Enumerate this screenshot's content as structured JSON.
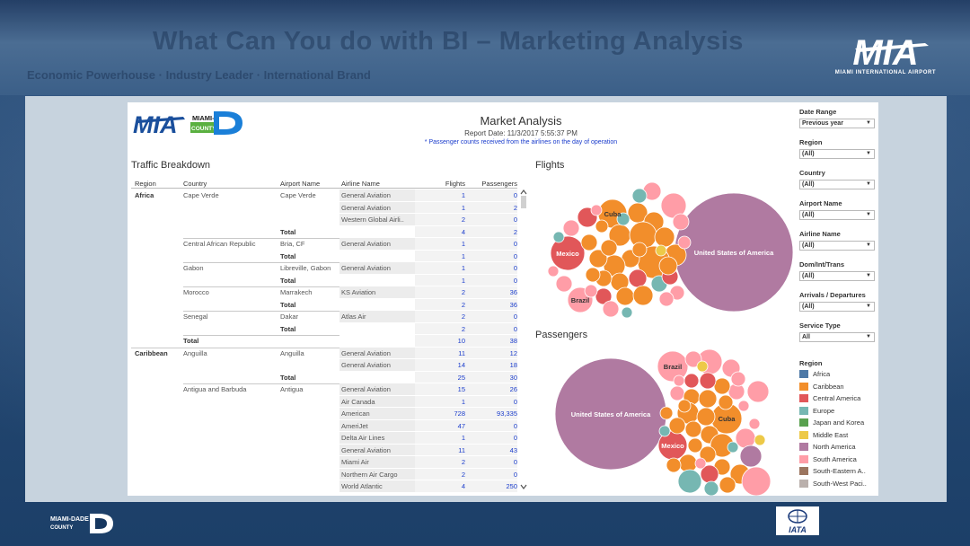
{
  "slide": {
    "title": "What Can You do with BI – Marketing Analysis",
    "subtitle": "Economic Powerhouse · Industry Leader · International Brand",
    "mia_logo_text": "MIA",
    "mia_logo_caption": "MIAMI INTERNATIONAL AIRPORT",
    "county_logo_text": "MIAMI-DADE COUNTY",
    "iata_logo_text": "IATA"
  },
  "dashboard": {
    "title": "Market Analysis",
    "report_date": "Report Date: 11/3/2017 5:55:37 PM",
    "note": "* Passenger counts received from the airlines on the day of operation",
    "traffic_title": "Traffic Breakdown",
    "flights_title": "Flights",
    "passengers_title": "Passengers",
    "table": {
      "headers": {
        "region": "Region",
        "country": "Country",
        "airport": "Airport Name",
        "airline": "Airline Name",
        "flights": "Flights",
        "passengers": "Passengers"
      },
      "rows": [
        {
          "region": "Africa",
          "country": "Cape Verde",
          "airport": "Cape Verde",
          "airline": "General Aviation",
          "flights": "1",
          "passengers": "0"
        },
        {
          "region": "",
          "country": "",
          "airport": "",
          "airline": "General Aviation",
          "flights": "1",
          "passengers": "2"
        },
        {
          "region": "",
          "country": "",
          "airport": "",
          "airline": "Western Global Airli..",
          "flights": "2",
          "passengers": "0"
        },
        {
          "region": "",
          "country": "",
          "airport": "Total",
          "airline": "",
          "flights": "4",
          "passengers": "2",
          "kind": "total"
        },
        {
          "region": "",
          "country": "Central African Republic",
          "airport": "Bria, CF",
          "airline": "General Aviation",
          "flights": "1",
          "passengers": "0"
        },
        {
          "region": "",
          "country": "",
          "airport": "Total",
          "airline": "",
          "flights": "1",
          "passengers": "0",
          "kind": "total"
        },
        {
          "region": "",
          "country": "Gabon",
          "airport": "Libreville, Gabon",
          "airline": "General Aviation",
          "flights": "1",
          "passengers": "0"
        },
        {
          "region": "",
          "country": "",
          "airport": "Total",
          "airline": "",
          "flights": "1",
          "passengers": "0",
          "kind": "total"
        },
        {
          "region": "",
          "country": "Morocco",
          "airport": "Marrakech",
          "airline": "KS Aviation",
          "flights": "2",
          "passengers": "36"
        },
        {
          "region": "",
          "country": "",
          "airport": "Total",
          "airline": "",
          "flights": "2",
          "passengers": "36",
          "kind": "total"
        },
        {
          "region": "",
          "country": "Senegal",
          "airport": "Dakar",
          "airline": "Atlas Air",
          "flights": "2",
          "passengers": "0"
        },
        {
          "region": "",
          "country": "",
          "airport": "Total",
          "airline": "",
          "flights": "2",
          "passengers": "0",
          "kind": "total"
        },
        {
          "region": "",
          "country": "Total",
          "airport": "",
          "airline": "",
          "flights": "10",
          "passengers": "38",
          "kind": "gtotal"
        },
        {
          "region": "Caribbean",
          "country": "Anguilla",
          "airport": "Anguilla",
          "airline": "General Aviation",
          "flights": "11",
          "passengers": "12"
        },
        {
          "region": "",
          "country": "",
          "airport": "",
          "airline": "General Aviation",
          "flights": "14",
          "passengers": "18"
        },
        {
          "region": "",
          "country": "",
          "airport": "Total",
          "airline": "",
          "flights": "25",
          "passengers": "30",
          "kind": "total"
        },
        {
          "region": "",
          "country": "Antigua and Barbuda",
          "airport": "Antigua",
          "airline": "General Aviation",
          "flights": "15",
          "passengers": "26"
        },
        {
          "region": "",
          "country": "",
          "airport": "",
          "airline": "Air Canada",
          "flights": "1",
          "passengers": "0"
        },
        {
          "region": "",
          "country": "",
          "airport": "",
          "airline": "American",
          "flights": "728",
          "passengers": "93,335"
        },
        {
          "region": "",
          "country": "",
          "airport": "",
          "airline": "AmeriJet",
          "flights": "47",
          "passengers": "0"
        },
        {
          "region": "",
          "country": "",
          "airport": "",
          "airline": "Delta Air Lines",
          "flights": "1",
          "passengers": "0"
        },
        {
          "region": "",
          "country": "",
          "airport": "",
          "airline": "General Aviation",
          "flights": "11",
          "passengers": "43"
        },
        {
          "region": "",
          "country": "",
          "airport": "",
          "airline": "Miami Air",
          "flights": "2",
          "passengers": "0"
        },
        {
          "region": "",
          "country": "",
          "airport": "",
          "airline": "Northern Air Cargo",
          "flights": "2",
          "passengers": "0"
        },
        {
          "region": "",
          "country": "",
          "airport": "",
          "airline": "World Atlantic",
          "flights": "4",
          "passengers": "250"
        }
      ]
    },
    "filters": [
      {
        "label": "Date Range",
        "value": "Previous year"
      },
      {
        "label": "Region",
        "value": "(All)"
      },
      {
        "label": "Country",
        "value": "(All)"
      },
      {
        "label": "Airport Name",
        "value": "(All)"
      },
      {
        "label": "Airline Name",
        "value": "(All)"
      },
      {
        "label": "Dom/Int/Trans",
        "value": "(All)"
      },
      {
        "label": "Arrivals / Departures",
        "value": "(All)"
      },
      {
        "label": "Service Type",
        "value": "All"
      }
    ],
    "legend": {
      "title": "Region",
      "items": [
        {
          "label": "Africa",
          "color": "#4e79a7"
        },
        {
          "label": "Caribbean",
          "color": "#f28e2b"
        },
        {
          "label": "Central America",
          "color": "#e15759"
        },
        {
          "label": "Europe",
          "color": "#76b7b2"
        },
        {
          "label": "Japan and Korea",
          "color": "#59a14f"
        },
        {
          "label": "Middle East",
          "color": "#edc948"
        },
        {
          "label": "North America",
          "color": "#b07aa1"
        },
        {
          "label": "South America",
          "color": "#ff9da7"
        },
        {
          "label": "South-Eastern A..",
          "color": "#9c755f"
        },
        {
          "label": "South-West Paci..",
          "color": "#bab0ac"
        }
      ]
    }
  },
  "chart_data": [
    {
      "type": "bubble",
      "title": "Flights",
      "labeled_bubbles": [
        {
          "label": "United States of America",
          "region": "North America"
        },
        {
          "label": "Cuba",
          "region": "Caribbean"
        },
        {
          "label": "Mexico",
          "region": "Central America"
        },
        {
          "label": "Brazil",
          "region": "South America"
        }
      ]
    },
    {
      "type": "bubble",
      "title": "Passengers",
      "labeled_bubbles": [
        {
          "label": "United States of America",
          "region": "North America"
        },
        {
          "label": "Brazil",
          "region": "South America"
        },
        {
          "label": "Cuba",
          "region": "Caribbean"
        },
        {
          "label": "Mexico",
          "region": "Central America"
        }
      ]
    }
  ]
}
